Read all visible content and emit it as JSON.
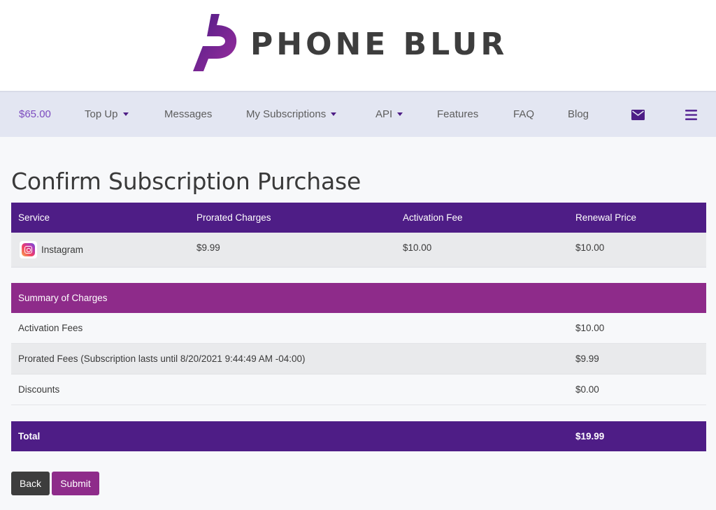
{
  "brand": {
    "name": "PHONE BLUR",
    "logo_gradient": [
      "#4e1d86",
      "#9b2d9e"
    ]
  },
  "nav": {
    "balance": "$65.00",
    "items": [
      {
        "label": "Top Up",
        "dropdown": true
      },
      {
        "label": "Messages",
        "dropdown": false
      },
      {
        "label": "My Subscriptions",
        "dropdown": true
      },
      {
        "label": "API",
        "dropdown": true
      },
      {
        "label": "Features",
        "dropdown": false
      },
      {
        "label": "FAQ",
        "dropdown": false
      },
      {
        "label": "Blog",
        "dropdown": false
      }
    ],
    "icons": [
      "envelope-icon",
      "hamburger-menu-icon"
    ]
  },
  "page": {
    "title": "Confirm Subscription Purchase"
  },
  "service_table": {
    "headers": [
      "Service",
      "Prorated Charges",
      "Activation Fee",
      "Renewal Price"
    ],
    "rows": [
      {
        "service": "Instagram",
        "icon": "instagram-icon",
        "prorated": "$9.99",
        "activation": "$10.00",
        "renewal": "$10.00"
      }
    ]
  },
  "summary": {
    "header": "Summary of Charges",
    "rows": [
      {
        "label": "Activation Fees",
        "value": "$10.00"
      },
      {
        "label": "Prorated Fees (Subscription lasts until 8/20/2021 9:44:49 AM -04:00)",
        "value": "$9.99"
      },
      {
        "label": "Discounts",
        "value": "$0.00"
      }
    ],
    "total_label": "Total",
    "total_value": "$19.99"
  },
  "actions": {
    "back_label": "Back",
    "submit_label": "Submit"
  },
  "colors": {
    "primary": "#4e1d86",
    "accent": "#8e2b8a",
    "navbar_bg": "#e3e6f2"
  }
}
